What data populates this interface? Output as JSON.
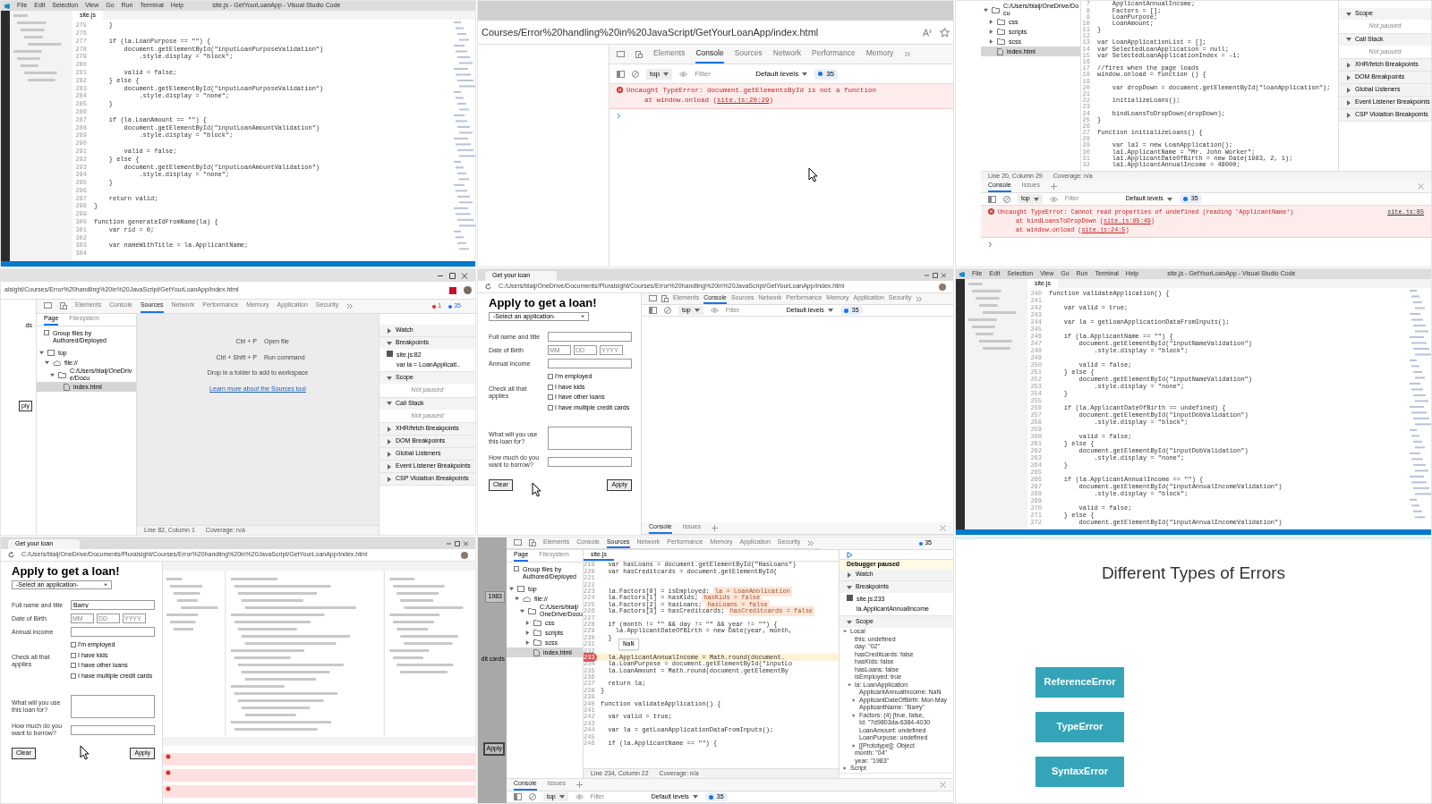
{
  "tiles": [
    {
      "kind": "editor",
      "title": "site.js - GetYourLoanApp - Visual Studio Code",
      "menu": [
        "File",
        "Edit",
        "Selection",
        "View",
        "Go",
        "Run",
        "Terminal",
        "Help"
      ],
      "tab": "site.js",
      "code": [
        {
          "n": "275",
          "t": "    }"
        },
        {
          "n": "276"
        },
        {
          "n": "277",
          "t": "    if (la.LoanPurpose == \"\") {"
        },
        {
          "n": "278",
          "t": "        document.getElementById(\"inputLoanPurposeValidation\")"
        },
        {
          "n": "279",
          "t": "            .style.display = \"block\";"
        },
        {
          "n": "280"
        },
        {
          "n": "281",
          "t": "        valid = false;"
        },
        {
          "n": "282",
          "t": "    } else {"
        },
        {
          "n": "283",
          "t": "        document.getElementById(\"inputLoanPurposeValidation\")"
        },
        {
          "n": "284",
          "t": "            .style.display = \"none\";"
        },
        {
          "n": "285",
          "t": "    }"
        },
        {
          "n": "286"
        },
        {
          "n": "287",
          "t": "    if (la.LoanAmount == \"\") {"
        },
        {
          "n": "288",
          "t": "        document.getElementById(\"inputLoanAmountValidation\")"
        },
        {
          "n": "289",
          "t": "            .style.display = \"block\";"
        },
        {
          "n": "290"
        },
        {
          "n": "291",
          "t": "        valid = false;"
        },
        {
          "n": "292",
          "t": "    } else {"
        },
        {
          "n": "293",
          "t": "        document.getElementById(\"inputLoanAmountValidation\")"
        },
        {
          "n": "294",
          "t": "            .style.display = \"none\";"
        },
        {
          "n": "295",
          "t": "    }"
        },
        {
          "n": "296"
        },
        {
          "n": "297",
          "t": "    return valid;"
        },
        {
          "n": "298",
          "t": "}"
        },
        {
          "n": "299"
        },
        {
          "n": "300",
          "t": "function generateIdFromName(la) {"
        },
        {
          "n": "301",
          "t": "    var rid = 0;"
        },
        {
          "n": "302"
        },
        {
          "n": "303",
          "t": "    var nameWithTitle = la.ApplicantName;"
        },
        {
          "n": "304"
        }
      ]
    },
    {
      "kind": "console_view",
      "url": "Courses/Error%20handling%20in%20JavaScript/GetYourLoanApp/index.html",
      "tabs": [
        {
          "label": "Elements",
          "selected": false
        },
        {
          "label": "Console",
          "selected": true
        },
        {
          "label": "Sources",
          "selected": false
        },
        {
          "label": "Network",
          "selected": false
        },
        {
          "label": "Performance",
          "selected": false
        },
        {
          "label": "Memory",
          "selected": false
        }
      ],
      "toolbar": {
        "context": "top",
        "placeholder": "Filter",
        "levels": "Default levels",
        "count": "35"
      },
      "messages": [
        {
          "lines": [
            {
              "text": "Uncaught TypeError: document.getElementsById is not a function"
            },
            {
              "text": "at window.onload (",
              "link": "site.js:20:29",
              "after": ")"
            }
          ]
        }
      ]
    },
    {
      "kind": "sources_console",
      "tree": [
        {
          "label": "C:/Users/blaij/OneDrive/Docu",
          "kind": "folder",
          "expanded": true,
          "selected": false,
          "children": [
            {
              "label": "css",
              "kind": "folder",
              "expanded": false,
              "selected": false
            },
            {
              "label": "scripts",
              "kind": "folder",
              "expanded": false,
              "selected": false
            },
            {
              "label": "scss",
              "kind": "folder",
              "expanded": false,
              "selected": false
            },
            {
              "label": "index.html",
              "kind": "file",
              "selected": true
            }
          ]
        }
      ],
      "code": [
        {
          "n": "7",
          "t": "    ApplicantAnnualIncome;"
        },
        {
          "n": "8",
          "t": "    Factors = [];"
        },
        {
          "n": "9",
          "t": "    LoanPurpose;"
        },
        {
          "n": "10",
          "t": "    LoanAmount;"
        },
        {
          "n": "11",
          "t": "}"
        },
        {
          "n": "12"
        },
        {
          "n": "13",
          "t": "var LoanApplicationList = [];"
        },
        {
          "n": "14",
          "t": "var SelectedLoanApplication = null;"
        },
        {
          "n": "15",
          "t": "var SelectedLoanApplicationIndex = -1;"
        },
        {
          "n": "16"
        },
        {
          "n": "17",
          "t": "//fires when the page loads"
        },
        {
          "n": "18",
          "t": "window.onload = function () {"
        },
        {
          "n": "19"
        },
        {
          "n": "20",
          "t": "    var dropDown = document.getElementById(\"loanApplication\");"
        },
        {
          "n": "21"
        },
        {
          "n": "22",
          "t": "    initializeLoans();"
        },
        {
          "n": "23"
        },
        {
          "n": "24",
          "t": "    bindLoansToDropDown(dropDown);"
        },
        {
          "n": "25",
          "t": "}"
        },
        {
          "n": "26"
        },
        {
          "n": "27",
          "t": "function initializeLoans() {"
        },
        {
          "n": "28"
        },
        {
          "n": "29",
          "t": "    var la1 = new LoanApplication();"
        },
        {
          "n": "30",
          "t": "    la1.ApplicantName = \"Mr. John Worker\";"
        },
        {
          "n": "31",
          "t": "    la1.ApplicantDateOfBirth = new Date(1983, 2, 1);"
        },
        {
          "n": "32",
          "t": "    la1.ApplicantAnnualIncome = 48000;"
        }
      ],
      "sections": [
        {
          "label": "Scope",
          "expanded": true,
          "note": "Not paused"
        },
        {
          "label": "Call Stack",
          "expanded": true,
          "note": "Not paused"
        },
        {
          "label": "XHR/fetch Breakpoints",
          "expanded": false
        },
        {
          "label": "DOM Breakpoints",
          "expanded": false
        },
        {
          "label": "Global Listeners",
          "expanded": false
        },
        {
          "label": "Event Listener Breakpoints",
          "expanded": false
        },
        {
          "label": "CSP Violation Breakpoints",
          "expanded": false
        }
      ],
      "status": [
        "Line 20, Column 29",
        "Coverage: n/a"
      ],
      "drawer_tabs": [
        {
          "label": "Console",
          "selected": true
        },
        {
          "label": "Issues",
          "selected": false
        }
      ],
      "toolbar": {
        "context": "top",
        "placeholder": "Filter",
        "levels": "Default levels",
        "count": "35"
      },
      "messages": [
        {
          "source": "site.js:85",
          "lines": [
            {
              "text": "Uncaught TypeError: Cannot read properties of undefined (reading 'ApplicantName')"
            },
            {
              "text": "at bindLoansToDropDown (",
              "link": "site.js:85:49",
              "after": ")"
            },
            {
              "text": "at window.onload (",
              "link": "site.js:24:5",
              "after": ")"
            }
          ]
        }
      ]
    },
    {
      "kind": "sources_empty",
      "url": "alsight/Courses/Error%20handling%20in%20JavaScript/GetYourLoanApp/index.html",
      "page_fragments": [
        "ds",
        "ply"
      ],
      "tabs": [
        {
          "label": "Elements",
          "selected": false
        },
        {
          "label": "Console",
          "selected": false
        },
        {
          "label": "Sources",
          "selected": true
        },
        {
          "label": "Network",
          "selected": false
        },
        {
          "label": "Performance",
          "selected": false
        },
        {
          "label": "Memory",
          "selected": false
        },
        {
          "label": "Application",
          "selected": false
        },
        {
          "label": "Security",
          "selected": false
        }
      ],
      "error_count": "1",
      "message_count": "35",
      "nav_tabs": [
        {
          "label": "Page",
          "selected": true
        },
        {
          "label": "Filesystem",
          "selected": false
        }
      ],
      "group_label": "Group files by Authored/Deployed",
      "group_checked": false,
      "tree": [
        {
          "label": "top",
          "kind": "frame",
          "expanded": true,
          "selected": false,
          "children": [
            {
              "label": "file://",
              "kind": "cloud",
              "expanded": true,
              "selected": false,
              "children": [
                {
                  "label": "C:/Users/blaij/OneDrive/Docu",
                  "kind": "folder",
                  "expanded": true,
                  "selected": false,
                  "children": [
                    {
                      "label": "index.html",
                      "kind": "file",
                      "selected": true
                    }
                  ]
                }
              ]
            }
          ]
        }
      ],
      "shortcuts": [
        {
          "keys": "Ctrl + P",
          "action": "Open file"
        },
        {
          "keys": "Ctrl + Shift + P",
          "action": "Run command"
        }
      ],
      "drop_hint": "Drop in a folder to add to workspace",
      "learn_link": "Learn more about the Sources tool",
      "sections": [
        {
          "label": "Watch",
          "expanded": false
        },
        {
          "label": "Breakpoints",
          "expanded": true,
          "breakpoints": [
            {
              "file": "site.js:82",
              "code": "var la = LoanApplicati..",
              "checked": true
            }
          ]
        },
        {
          "label": "Scope",
          "expanded": true,
          "note": "Not paused"
        },
        {
          "label": "Call Stack",
          "expanded": true,
          "note": "Not paused"
        },
        {
          "label": "XHR/fetch Breakpoints",
          "expanded": false
        },
        {
          "label": "DOM Breakpoints",
          "expanded": false
        },
        {
          "label": "Global Listeners",
          "expanded": false
        },
        {
          "label": "Event Listener Breakpoints",
          "expanded": false
        },
        {
          "label": "CSP Violation Breakpoints",
          "expanded": false
        }
      ],
      "status": [
        "Line 82, Column 1",
        "Coverage: n/a"
      ]
    },
    {
      "kind": "form_console",
      "tab": "Get your loan",
      "url": "C:/Users/blaij/OneDrive/Documents/Pluralsight/Courses/Error%20handling%20in%20JavaScript/GetYourLoanApp/index.html",
      "form": {
        "heading": "Apply to get a loan!",
        "select": "-Select an application-",
        "name_label": "Full name and title",
        "dob_label": "Date of Birth",
        "dob_placeholders": [
          "MM",
          "DD",
          "YYYY"
        ],
        "income_label": "Annual income",
        "check_label": "Check all that applies",
        "checks": [
          {
            "label": "I'm employed",
            "checked": false
          },
          {
            "label": "I have kids",
            "checked": false
          },
          {
            "label": "I have other loans",
            "checked": false
          },
          {
            "label": "I have multiple credit cards",
            "checked": false
          }
        ],
        "purpose_label": "What will you use this loan for?",
        "amount_label": "How much do you want to borrow?",
        "buttons": [
          "Clear",
          "Apply"
        ]
      },
      "tabs": [
        {
          "label": "Elements",
          "selected": false
        },
        {
          "label": "Console",
          "selected": true
        },
        {
          "label": "Sources",
          "selected": false
        },
        {
          "label": "Network",
          "selected": false
        },
        {
          "label": "Performance",
          "selected": false
        },
        {
          "label": "Memory",
          "selected": false
        },
        {
          "label": "Application",
          "selected": false
        },
        {
          "label": "Security",
          "selected": false
        }
      ],
      "toolbar": {
        "context": "top",
        "placeholder": "Filter",
        "levels": "Default levels",
        "count": "35"
      },
      "drawer_tabs": [
        {
          "label": "Console",
          "selected": true
        },
        {
          "label": "Issues",
          "selected": false
        }
      ]
    },
    {
      "kind": "editor",
      "title": "site.js - GetYourLoanApp - Visual Studio Code",
      "menu": [
        "File",
        "Edit",
        "Selection",
        "View",
        "Go",
        "Run",
        "Terminal",
        "Help"
      ],
      "tab": "site.js",
      "code": [
        {
          "n": "240",
          "t": "function validateApplication() {"
        },
        {
          "n": "241"
        },
        {
          "n": "242",
          "t": "    var valid = true;"
        },
        {
          "n": "243"
        },
        {
          "n": "244",
          "t": "    var la = getLoanApplicationDataFromInputs();"
        },
        {
          "n": "245"
        },
        {
          "n": "246",
          "t": "    if (la.ApplicantName == \"\") {"
        },
        {
          "n": "247",
          "t": "        document.getElementById(\"inputNameValidation\")"
        },
        {
          "n": "248",
          "t": "            .style.display = \"block\";"
        },
        {
          "n": "249"
        },
        {
          "n": "250",
          "t": "        valid = false;"
        },
        {
          "n": "251",
          "t": "    } else {"
        },
        {
          "n": "252",
          "t": "        document.getElementById(\"inputNameValidation\")"
        },
        {
          "n": "253",
          "t": "            .style.display = \"none\";"
        },
        {
          "n": "254",
          "t": "    }"
        },
        {
          "n": "255"
        },
        {
          "n": "256",
          "t": "    if (la.ApplicantDateOfBirth == undefined) {"
        },
        {
          "n": "257",
          "t": "        document.getElementById(\"inputDobValidation\")"
        },
        {
          "n": "258",
          "t": "            .style.display = \"block\";"
        },
        {
          "n": "259"
        },
        {
          "n": "260",
          "t": "        valid = false;"
        },
        {
          "n": "261",
          "t": "    } else {"
        },
        {
          "n": "262",
          "t": "        document.getElementById(\"inputDobValidation\")"
        },
        {
          "n": "263",
          "t": "            .style.display = \"none\";"
        },
        {
          "n": "264",
          "t": "    }"
        },
        {
          "n": "265"
        },
        {
          "n": "266",
          "t": "    if (la.ApplicantAnnualIncome == \"\") {"
        },
        {
          "n": "267",
          "t": "        document.getElementById(\"inputAnnualIncomeValidation\")"
        },
        {
          "n": "268",
          "t": "            .style.display = \"block\";"
        },
        {
          "n": "269"
        },
        {
          "n": "270",
          "t": "        valid = false;"
        },
        {
          "n": "271",
          "t": "    } else {"
        },
        {
          "n": "272",
          "t": "        document.getElementById(\"inputAnnualIncomeValidation\")"
        }
      ]
    },
    {
      "kind": "form_sources",
      "tab": "Get your loan",
      "url": "C:/Users/blaij/OneDrive/Documents/Pluralsight/Courses/Error%20handling%20in%20JavaScript/GetYourLoanApp/index.html",
      "form": {
        "heading": "Apply to get a loan!",
        "select": "-Select an application-",
        "name_label": "Full name and title",
        "name_value": "Barry",
        "dob_label": "Date of Birth",
        "dob_placeholders": [
          "MM",
          "DD",
          "YYYY"
        ],
        "income_label": "Annual income",
        "check_label": "Check all that applies",
        "checks": [
          {
            "label": "I'm employed",
            "checked": false
          },
          {
            "label": "I have kids",
            "checked": false
          },
          {
            "label": "I have other loans",
            "checked": false
          },
          {
            "label": "I have multiple credit cards",
            "checked": false
          }
        ],
        "purpose_label": "What will you use this loan for?",
        "amount_label": "How much do you want to borrow?",
        "buttons": [
          "Clear",
          "Apply"
        ]
      }
    },
    {
      "kind": "debugger",
      "page_fragments": {
        "year": "1983",
        "cards": "dit cards",
        "button": "Apply"
      },
      "tabs": [
        {
          "label": "Elements",
          "selected": false
        },
        {
          "label": "Console",
          "selected": false
        },
        {
          "label": "Sources",
          "selected": true
        },
        {
          "label": "Network",
          "selected": false
        },
        {
          "label": "Performance",
          "selected": false
        },
        {
          "label": "Memory",
          "selected": false
        },
        {
          "label": "Application",
          "selected": false
        },
        {
          "label": "Security",
          "selected": false
        }
      ],
      "message_count": "35",
      "nav_tabs": [
        {
          "label": "Page",
          "selected": true
        },
        {
          "label": "Filesystem",
          "selected": false
        }
      ],
      "group_label": "Group files by Authored/Deployed",
      "group_checked": false,
      "tree": [
        {
          "label": "top",
          "kind": "frame",
          "expanded": true,
          "selected": false,
          "children": [
            {
              "label": "file://",
              "kind": "cloud",
              "expanded": true,
              "selected": false,
              "children": [
                {
                  "label": "C:/Users/blaij/OneDrive/Docu",
                  "kind": "folder",
                  "expanded": true,
                  "selected": false,
                  "children": [
                    {
                      "label": "css",
                      "kind": "folder",
                      "expanded": false,
                      "selected": false
                    },
                    {
                      "label": "scripts",
                      "kind": "folder",
                      "expanded": false,
                      "selected": false
                    },
                    {
                      "label": "scss",
                      "kind": "folder",
                      "expanded": false,
                      "selected": false
                    },
                    {
                      "label": "index.html",
                      "kind": "file",
                      "selected": true
                    }
                  ]
                }
              ]
            }
          ]
        }
      ],
      "file_tab": "site.js",
      "code": [
        {
          "n": "219",
          "t": "  var hasLoans = document.getElementById(\"HasLoans\")",
          "breakpoint": false
        },
        {
          "n": "220",
          "t": "  var hasCreditcards = document.getElementById(",
          "breakpoint": false
        },
        {
          "n": "221",
          "breakpoint": false
        },
        {
          "n": "222",
          "breakpoint": false
        },
        {
          "n": "223",
          "t": "  la.Factors[0] = isEmployed;",
          "val": "la = LoanApplication",
          "breakpoint": false
        },
        {
          "n": "224",
          "t": "  la.Factors[1] = hasKids;",
          "val": "hasKids = false",
          "breakpoint": false
        },
        {
          "n": "225",
          "t": "  la.Factors[2] = hasLoans;",
          "val": "hasLoans = false",
          "breakpoint": false
        },
        {
          "n": "226",
          "t": "  la.Factors[3] = hasCreditcards;",
          "val": "hasCreditcards = false",
          "breakpoint": false
        },
        {
          "n": "227",
          "breakpoint": false
        },
        {
          "n": "228",
          "t": "  if (month != \"\" && day != \"\" && year != \"\") {",
          "breakpoint": false
        },
        {
          "n": "229",
          "t": "    la.ApplicantDateOfBirth = new Date(year, month,",
          "breakpoint": false
        },
        {
          "n": "230",
          "t": "  }",
          "breakpoint": false
        },
        {
          "n": "231",
          "popup": "NaN",
          "breakpoint": false
        },
        {
          "n": "232",
          "breakpoint": false
        },
        {
          "n": "233",
          "t": "  la.ApplicantAnnualIncome = Math.round(document.",
          "breakpoint": true
        },
        {
          "n": "234",
          "t": "  la.LoanPurpose = document.getElementById(\"inputLo",
          "breakpoint": false
        },
        {
          "n": "235",
          "t": "  la.LoanAmount = Math.round(document.getElementBy",
          "breakpoint": false
        },
        {
          "n": "236",
          "breakpoint": false
        },
        {
          "n": "237",
          "t": "  return la;",
          "breakpoint": false
        },
        {
          "n": "238",
          "t": "}",
          "breakpoint": false
        },
        {
          "n": "239",
          "breakpoint": false
        },
        {
          "n": "240",
          "t": "function validateApplication() {",
          "breakpoint": false
        },
        {
          "n": "241",
          "breakpoint": false
        },
        {
          "n": "242",
          "t": "  var valid = true;",
          "breakpoint": false
        },
        {
          "n": "243",
          "breakpoint": false
        },
        {
          "n": "244",
          "t": "  var la = getLoanApplicationDataFromInputs();",
          "breakpoint": false
        },
        {
          "n": "245",
          "breakpoint": false
        },
        {
          "n": "246",
          "t": "  if (la.ApplicantName == \"\") {",
          "breakpoint": false
        }
      ],
      "paused_banner": "Debugger paused",
      "sections": [
        {
          "label": "Watch",
          "expanded": false
        },
        {
          "label": "Breakpoints",
          "expanded": true,
          "breakpoints": [
            {
              "file": "site.js:233",
              "code": "la.ApplicantAnnualIncome",
              "checked": true
            }
          ]
        },
        {
          "label": "Scope",
          "expanded": true,
          "scope": [
            {
              "label": "Local",
              "expanded": true,
              "children": [
                {
                  "label": "this: undefined"
                },
                {
                  "label": "day: \"02\""
                },
                {
                  "label": "hasCreditcards: false"
                },
                {
                  "label": "hasKids: false"
                },
                {
                  "label": "hasLoans: false"
                },
                {
                  "label": "isEmployed: true"
                },
                {
                  "label": "la: LoanApplication",
                  "expanded": true,
                  "children": [
                    {
                      "label": "ApplicantAnnualIncome: NaN"
                    },
                    {
                      "label": "ApplicantDateOfBirth: Mon May",
                      "expanded": false
                    },
                    {
                      "label": "ApplicantName: \"Barry\""
                    },
                    {
                      "label": "Factors: (4) [true, false,",
                      "expanded": false
                    },
                    {
                      "label": "Id: \"7d9803da-6384-4030"
                    },
                    {
                      "label": "LoanAmount: undefined"
                    },
                    {
                      "label": "LoanPurpose: undefined"
                    },
                    {
                      "label": "[[Prototype]]: Object",
                      "expanded": false
                    }
                  ]
                },
                {
                  "label": "month: \"04\""
                },
                {
                  "label": "year: \"1983\""
                }
              ]
            },
            {
              "label": "Script",
              "expanded": false
            }
          ]
        }
      ],
      "status": [
        "Line 234, Column 22",
        "Coverage: n/a"
      ],
      "drawer_tabs": [
        {
          "label": "Console",
          "selected": true
        },
        {
          "label": "Issues",
          "selected": false
        }
      ],
      "toolbar": {
        "context": "top",
        "placeholder": "Filter",
        "levels": "Default levels",
        "count": "35"
      }
    },
    {
      "kind": "slide",
      "title": "Different Types of Errors",
      "items": [
        "ReferenceError",
        "TypeError",
        "SyntaxError"
      ]
    }
  ]
}
